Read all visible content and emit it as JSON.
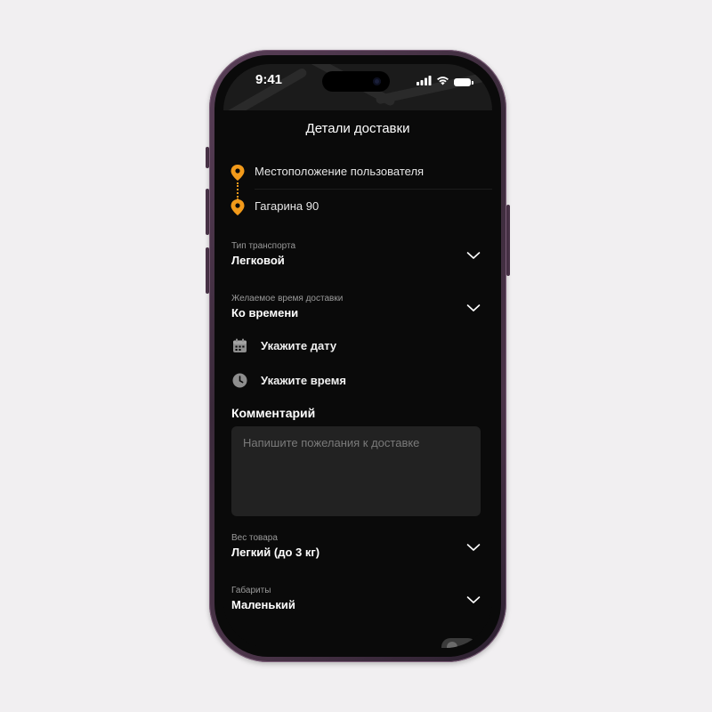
{
  "status_bar": {
    "time": "9:41"
  },
  "header": {
    "title": "Детали доставки"
  },
  "route": {
    "from": "Местоположение пользователя",
    "to": "Гагарина 90",
    "pin_color": "#f29a1a"
  },
  "transport": {
    "caption": "Тип транспорта",
    "value": "Легковой"
  },
  "delivery_time": {
    "caption": "Желаемое время доставки",
    "value": "Ко времени"
  },
  "date_picker": {
    "label": "Укажите дату",
    "icon": "calendar-icon"
  },
  "time_picker": {
    "label": "Укажите время",
    "icon": "clock-icon"
  },
  "comment": {
    "title": "Комментарий",
    "placeholder": "Напишите пожелания к доставке"
  },
  "weight": {
    "caption": "Вес товара",
    "value": "Легкий (до 3 кг)"
  },
  "dimensions": {
    "caption": "Габариты",
    "value": "Маленький"
  },
  "colors": {
    "background": "#0a0a0a",
    "accent": "#f29a1a",
    "input_bg": "#222222",
    "caption": "#9a9a9a"
  }
}
